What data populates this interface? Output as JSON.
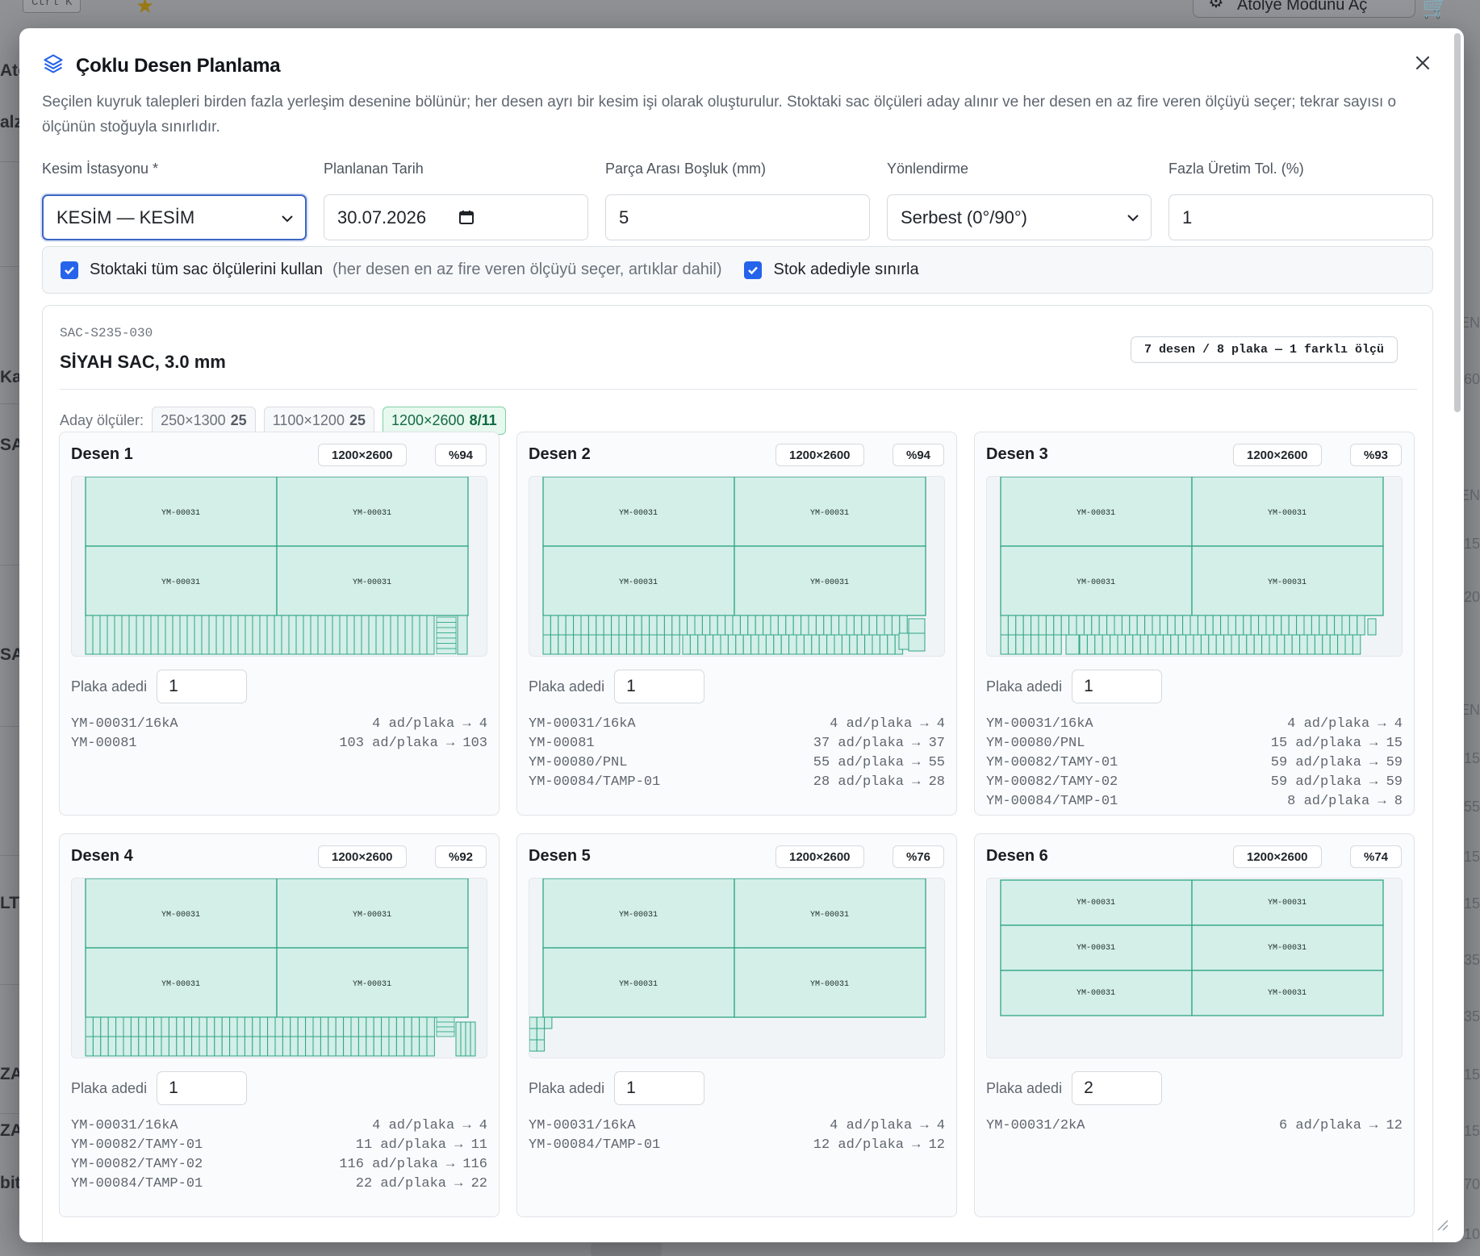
{
  "background": {
    "shortcut": "Ctrl K",
    "atolye_button": "Atölye Modunu Aç",
    "left_fragments": [
      "Atö",
      "alz",
      "Ka",
      "SA",
      "SA",
      "LT",
      "ZA",
      "ZA",
      "bitl"
    ],
    "right_fragments": [
      "EN",
      "60",
      "EN",
      "15",
      "20",
      "EN",
      "15",
      "55",
      "15",
      "15",
      "35",
      "35",
      "15",
      "15",
      "70",
      "10"
    ]
  },
  "modal": {
    "title": "Çoklu Desen Planlama",
    "description": "Seçilen kuyruk talepleri birden fazla yerleşim desenine bölünür; her desen ayrı bir kesim işi olarak oluşturulur. Stoktaki sac ölçüleri aday alınır ve her desen en az fire veren ölçüyü seçer; tekrar sayısı o ölçünün stoğuyla sınırlıdır.",
    "fields": {
      "station": {
        "label": "Kesim İstasyonu *",
        "value": "KESİM — KESİM"
      },
      "date": {
        "label": "Planlanan Tarih",
        "value": "30.07.2026"
      },
      "gap": {
        "label": "Parça Arası Boşluk (mm)",
        "value": "5"
      },
      "orientation": {
        "label": "Yönlendirme",
        "value": "Serbest (0°/90°)"
      },
      "tolerance": {
        "label": "Fazla Üretim Tol. (%)",
        "value": "1"
      }
    },
    "options": {
      "use_all_sizes": {
        "label": "Stoktaki tüm sac ölçülerini kullan",
        "hint": "(her desen en az fire veren ölçüyü seçer, artıklar dahil)",
        "checked": true
      },
      "limit_by_stock": {
        "label": "Stok adediyle sınırla",
        "checked": true
      }
    },
    "colors": {
      "accent": "#2563eb",
      "part_fill": "#d3efe7",
      "part_stroke": "#2fa585",
      "active_candidate": "#e7f8ef"
    }
  },
  "material": {
    "code": "SAC-S235-030",
    "name": "SİYAH SAC, 3.0 mm",
    "summary": "7 desen / 8 plaka — 1 farklı ölçü",
    "candidates_label": "Aday ölçüler:",
    "candidates": [
      {
        "size": "250×1300",
        "count": "25",
        "active": false
      },
      {
        "size": "1100×1200",
        "count": "25",
        "active": false
      },
      {
        "size": "1200×2600",
        "count": "8/11",
        "active": true
      }
    ],
    "qty_label": "Plaka adedi",
    "patterns": [
      {
        "title": "Desen 1",
        "size": "1200×2600",
        "util": "%94",
        "qty": "1",
        "layout": "a",
        "parts": [
          {
            "code": "YM-00031/16kA",
            "calc": "4 ad/plaka → 4"
          },
          {
            "code": "YM-00081",
            "calc": "103 ad/plaka → 103"
          }
        ]
      },
      {
        "title": "Desen 2",
        "size": "1200×2600",
        "util": "%94",
        "qty": "1",
        "layout": "b",
        "parts": [
          {
            "code": "YM-00031/16kA",
            "calc": "4 ad/plaka → 4"
          },
          {
            "code": "YM-00081",
            "calc": "37 ad/plaka → 37"
          },
          {
            "code": "YM-00080/PNL",
            "calc": "55 ad/plaka → 55"
          },
          {
            "code": "YM-00084/TAMP-01",
            "calc": "28 ad/plaka → 28"
          }
        ]
      },
      {
        "title": "Desen 3",
        "size": "1200×2600",
        "util": "%93",
        "qty": "1",
        "layout": "c",
        "parts": [
          {
            "code": "YM-00031/16kA",
            "calc": "4 ad/plaka → 4"
          },
          {
            "code": "YM-00080/PNL",
            "calc": "15 ad/plaka → 15"
          },
          {
            "code": "YM-00082/TAMY-01",
            "calc": "59 ad/plaka → 59"
          },
          {
            "code": "YM-00082/TAMY-02",
            "calc": "59 ad/plaka → 59"
          },
          {
            "code": "YM-00084/TAMP-01",
            "calc": "8 ad/plaka → 8"
          }
        ]
      },
      {
        "title": "Desen 4",
        "size": "1200×2600",
        "util": "%92",
        "qty": "1",
        "layout": "d",
        "parts": [
          {
            "code": "YM-00031/16kA",
            "calc": "4 ad/plaka → 4"
          },
          {
            "code": "YM-00082/TAMY-01",
            "calc": "11 ad/plaka → 11"
          },
          {
            "code": "YM-00082/TAMY-02",
            "calc": "116 ad/plaka → 116"
          },
          {
            "code": "YM-00084/TAMP-01",
            "calc": "22 ad/plaka → 22"
          }
        ]
      },
      {
        "title": "Desen 5",
        "size": "1200×2600",
        "util": "%76",
        "qty": "1",
        "layout": "e",
        "parts": [
          {
            "code": "YM-00031/16kA",
            "calc": "4 ad/plaka → 4"
          },
          {
            "code": "YM-00084/TAMP-01",
            "calc": "12 ad/plaka → 12"
          }
        ]
      },
      {
        "title": "Desen 6",
        "size": "1200×2600",
        "util": "%74",
        "qty": "2",
        "layout": "f",
        "parts": [
          {
            "code": "YM-00031/2kA",
            "calc": "6 ad/plaka → 12"
          }
        ]
      }
    ],
    "part_label": "YM-00031"
  }
}
